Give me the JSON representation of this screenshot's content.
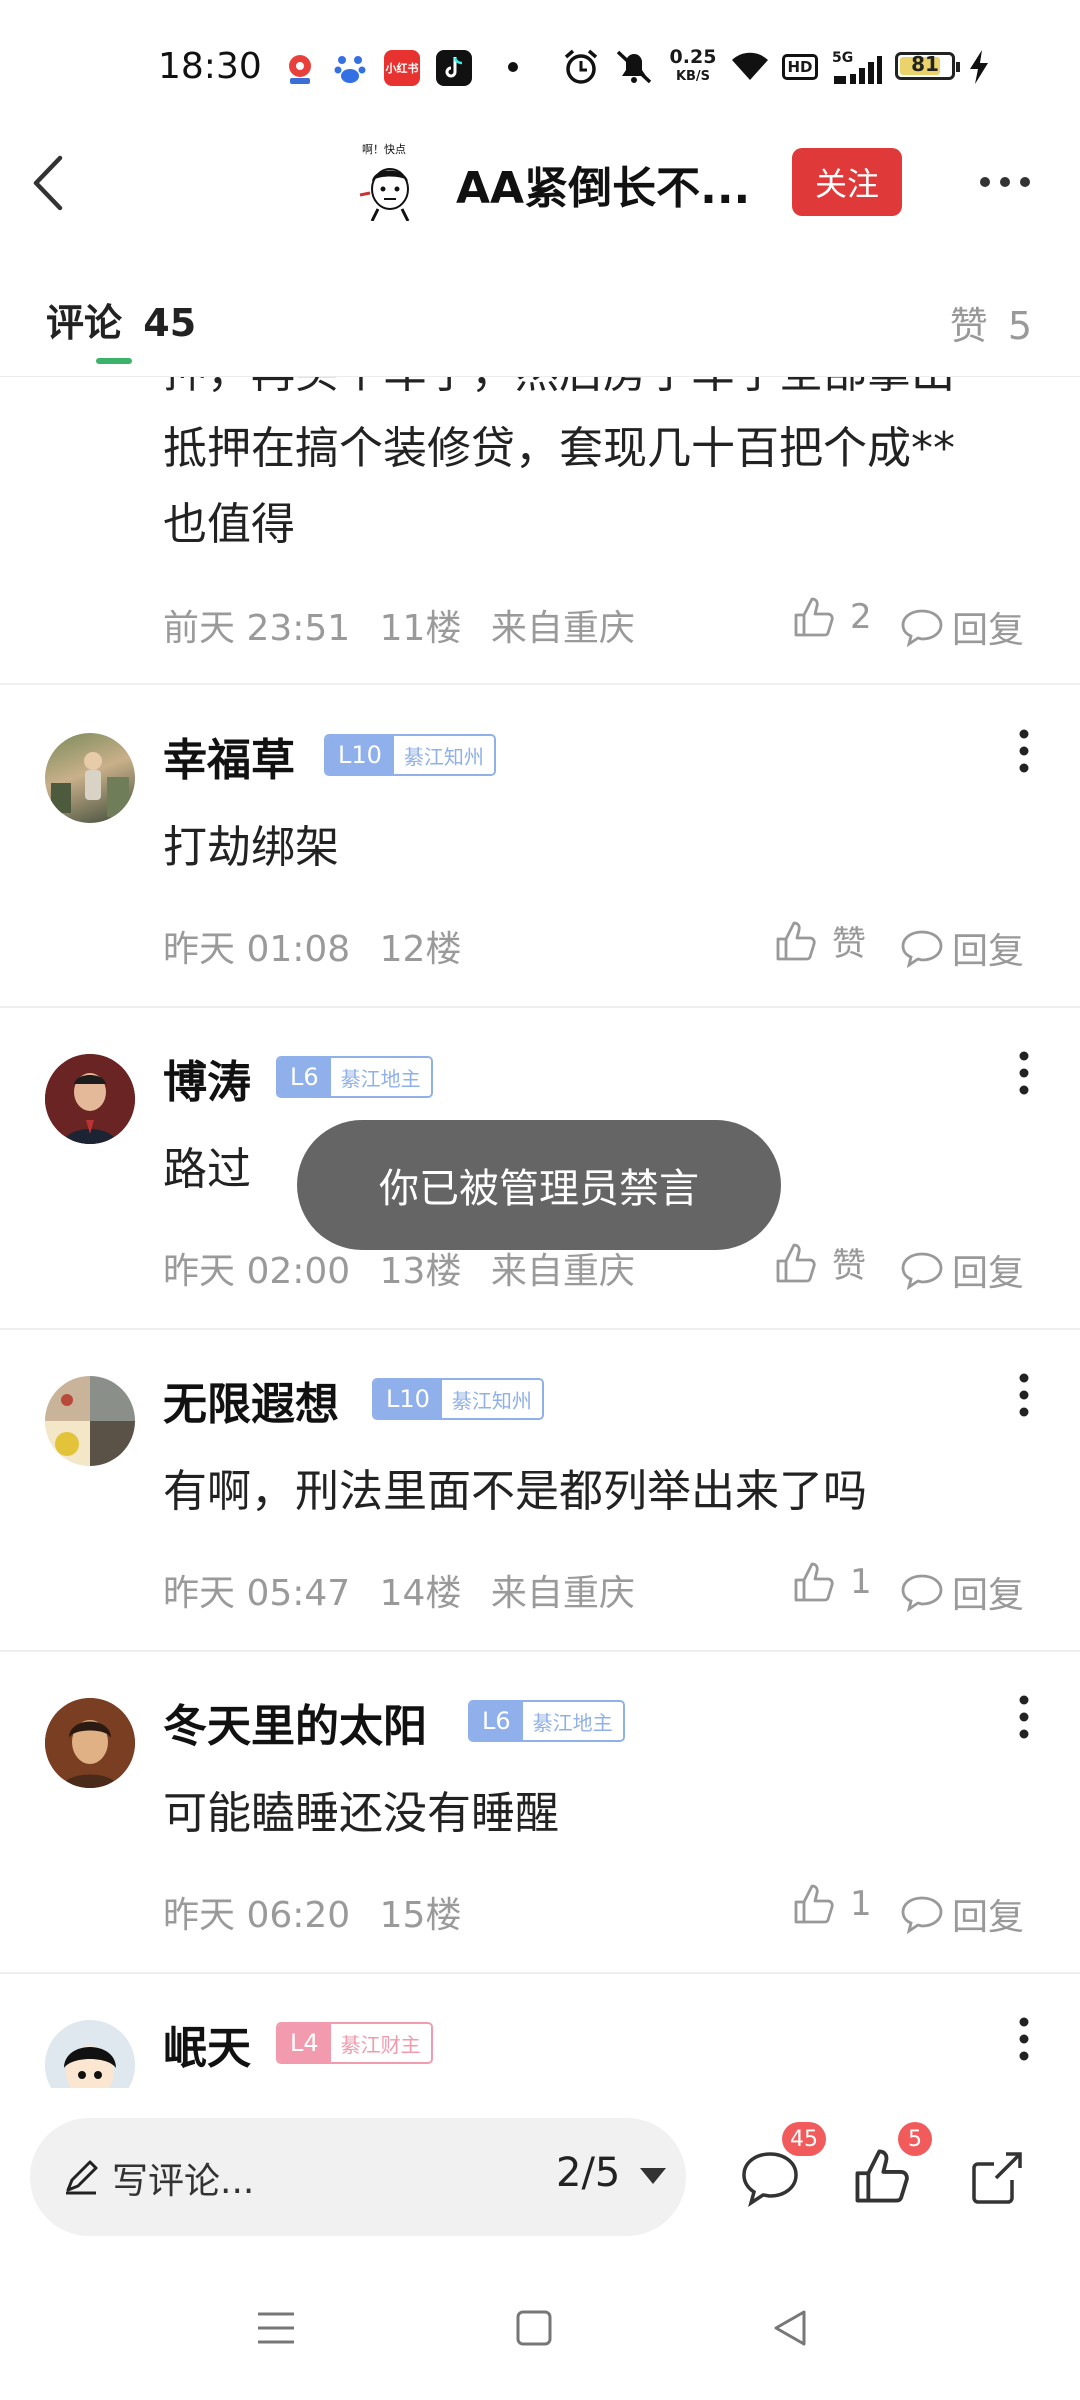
{
  "status_bar": {
    "time": "18:30",
    "network_speed_value": "0.25",
    "network_speed_unit": "KB/S",
    "hd_label": "HD",
    "signal_label": "5G",
    "battery": "81"
  },
  "header": {
    "title": "AA紧倒长不...",
    "follow_label": "关注",
    "avatar_caption": "啊！快点"
  },
  "tabs": {
    "comments_label": "评论",
    "comments_count": "45",
    "likes_label": "赞",
    "likes_count": "5"
  },
  "partial_comment": {
    "text_line_top": "押，再买个车子，然后房子车子全部拿出",
    "text_line1": "抵押在搞个装修贷，套现几十百把个成**",
    "text_line2": "也值得",
    "time": "前天 23:51",
    "floor": "11楼",
    "location": "来自重庆",
    "likes": "2",
    "reply_label": "回复"
  },
  "comments": [
    {
      "name": "幸福草",
      "level": "L10",
      "title": "綦江知州",
      "text": "打劫绑架",
      "time": "昨天 01:08",
      "floor": "12楼",
      "location": "",
      "likes": "赞",
      "reply_label": "回复"
    },
    {
      "name": "博涛",
      "level": "L6",
      "title": "綦江地主",
      "text": "路过",
      "time": "昨天 02:00",
      "floor": "13楼",
      "location": "来自重庆",
      "likes": "赞",
      "reply_label": "回复"
    },
    {
      "name": "无限遐想",
      "level": "L10",
      "title": "綦江知州",
      "text": "有啊，刑法里面不是都列举出来了吗",
      "time": "昨天 05:47",
      "floor": "14楼",
      "location": "来自重庆",
      "likes": "1",
      "reply_label": "回复"
    },
    {
      "name": "冬天里的太阳",
      "level": "L6",
      "title": "綦江地主",
      "text": "可能瞌睡还没有睡醒",
      "time": "昨天 06:20",
      "floor": "15楼",
      "location": "",
      "likes": "1",
      "reply_label": "回复"
    },
    {
      "name": "岷天",
      "level": "L4",
      "title": "綦江财主"
    }
  ],
  "toast": "你已被管理员禁言",
  "bottom_bar": {
    "write_placeholder": "写评论...",
    "page_indicator": "2/5",
    "comment_badge": "45",
    "like_badge": "5"
  },
  "colors": {
    "accent_red": "#e0393a",
    "badge_blue": "#8fb0ea",
    "badge_pink": "#f29aae",
    "tab_green": "#3cb36b"
  }
}
